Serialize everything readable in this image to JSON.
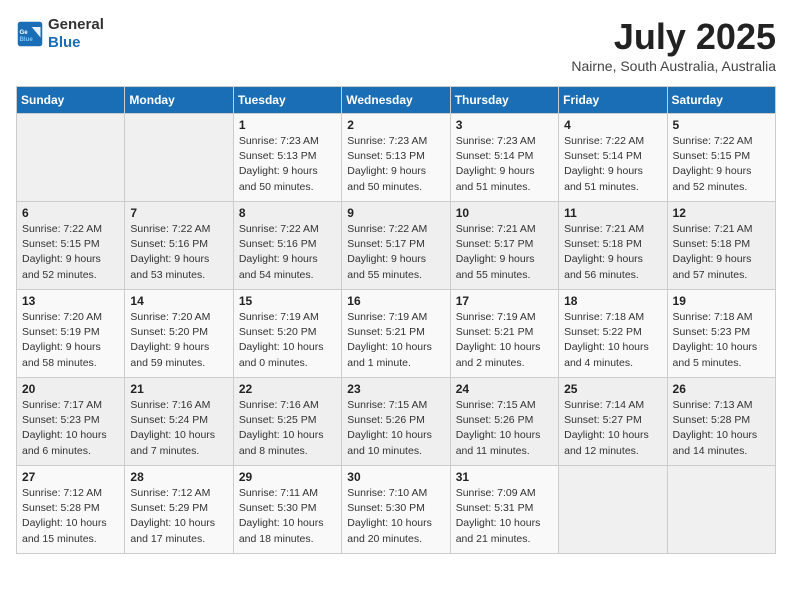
{
  "logo": {
    "general": "General",
    "blue": "Blue"
  },
  "title": {
    "month_year": "July 2025",
    "location": "Nairne, South Australia, Australia"
  },
  "days_of_week": [
    "Sunday",
    "Monday",
    "Tuesday",
    "Wednesday",
    "Thursday",
    "Friday",
    "Saturday"
  ],
  "weeks": [
    [
      {
        "day": "",
        "info": ""
      },
      {
        "day": "",
        "info": ""
      },
      {
        "day": "1",
        "info": "Sunrise: 7:23 AM\nSunset: 5:13 PM\nDaylight: 9 hours and 50 minutes."
      },
      {
        "day": "2",
        "info": "Sunrise: 7:23 AM\nSunset: 5:13 PM\nDaylight: 9 hours and 50 minutes."
      },
      {
        "day": "3",
        "info": "Sunrise: 7:23 AM\nSunset: 5:14 PM\nDaylight: 9 hours and 51 minutes."
      },
      {
        "day": "4",
        "info": "Sunrise: 7:22 AM\nSunset: 5:14 PM\nDaylight: 9 hours and 51 minutes."
      },
      {
        "day": "5",
        "info": "Sunrise: 7:22 AM\nSunset: 5:15 PM\nDaylight: 9 hours and 52 minutes."
      }
    ],
    [
      {
        "day": "6",
        "info": "Sunrise: 7:22 AM\nSunset: 5:15 PM\nDaylight: 9 hours and 52 minutes."
      },
      {
        "day": "7",
        "info": "Sunrise: 7:22 AM\nSunset: 5:16 PM\nDaylight: 9 hours and 53 minutes."
      },
      {
        "day": "8",
        "info": "Sunrise: 7:22 AM\nSunset: 5:16 PM\nDaylight: 9 hours and 54 minutes."
      },
      {
        "day": "9",
        "info": "Sunrise: 7:22 AM\nSunset: 5:17 PM\nDaylight: 9 hours and 55 minutes."
      },
      {
        "day": "10",
        "info": "Sunrise: 7:21 AM\nSunset: 5:17 PM\nDaylight: 9 hours and 55 minutes."
      },
      {
        "day": "11",
        "info": "Sunrise: 7:21 AM\nSunset: 5:18 PM\nDaylight: 9 hours and 56 minutes."
      },
      {
        "day": "12",
        "info": "Sunrise: 7:21 AM\nSunset: 5:18 PM\nDaylight: 9 hours and 57 minutes."
      }
    ],
    [
      {
        "day": "13",
        "info": "Sunrise: 7:20 AM\nSunset: 5:19 PM\nDaylight: 9 hours and 58 minutes."
      },
      {
        "day": "14",
        "info": "Sunrise: 7:20 AM\nSunset: 5:20 PM\nDaylight: 9 hours and 59 minutes."
      },
      {
        "day": "15",
        "info": "Sunrise: 7:19 AM\nSunset: 5:20 PM\nDaylight: 10 hours and 0 minutes."
      },
      {
        "day": "16",
        "info": "Sunrise: 7:19 AM\nSunset: 5:21 PM\nDaylight: 10 hours and 1 minute."
      },
      {
        "day": "17",
        "info": "Sunrise: 7:19 AM\nSunset: 5:21 PM\nDaylight: 10 hours and 2 minutes."
      },
      {
        "day": "18",
        "info": "Sunrise: 7:18 AM\nSunset: 5:22 PM\nDaylight: 10 hours and 4 minutes."
      },
      {
        "day": "19",
        "info": "Sunrise: 7:18 AM\nSunset: 5:23 PM\nDaylight: 10 hours and 5 minutes."
      }
    ],
    [
      {
        "day": "20",
        "info": "Sunrise: 7:17 AM\nSunset: 5:23 PM\nDaylight: 10 hours and 6 minutes."
      },
      {
        "day": "21",
        "info": "Sunrise: 7:16 AM\nSunset: 5:24 PM\nDaylight: 10 hours and 7 minutes."
      },
      {
        "day": "22",
        "info": "Sunrise: 7:16 AM\nSunset: 5:25 PM\nDaylight: 10 hours and 8 minutes."
      },
      {
        "day": "23",
        "info": "Sunrise: 7:15 AM\nSunset: 5:26 PM\nDaylight: 10 hours and 10 minutes."
      },
      {
        "day": "24",
        "info": "Sunrise: 7:15 AM\nSunset: 5:26 PM\nDaylight: 10 hours and 11 minutes."
      },
      {
        "day": "25",
        "info": "Sunrise: 7:14 AM\nSunset: 5:27 PM\nDaylight: 10 hours and 12 minutes."
      },
      {
        "day": "26",
        "info": "Sunrise: 7:13 AM\nSunset: 5:28 PM\nDaylight: 10 hours and 14 minutes."
      }
    ],
    [
      {
        "day": "27",
        "info": "Sunrise: 7:12 AM\nSunset: 5:28 PM\nDaylight: 10 hours and 15 minutes."
      },
      {
        "day": "28",
        "info": "Sunrise: 7:12 AM\nSunset: 5:29 PM\nDaylight: 10 hours and 17 minutes."
      },
      {
        "day": "29",
        "info": "Sunrise: 7:11 AM\nSunset: 5:30 PM\nDaylight: 10 hours and 18 minutes."
      },
      {
        "day": "30",
        "info": "Sunrise: 7:10 AM\nSunset: 5:30 PM\nDaylight: 10 hours and 20 minutes."
      },
      {
        "day": "31",
        "info": "Sunrise: 7:09 AM\nSunset: 5:31 PM\nDaylight: 10 hours and 21 minutes."
      },
      {
        "day": "",
        "info": ""
      },
      {
        "day": "",
        "info": ""
      }
    ]
  ]
}
